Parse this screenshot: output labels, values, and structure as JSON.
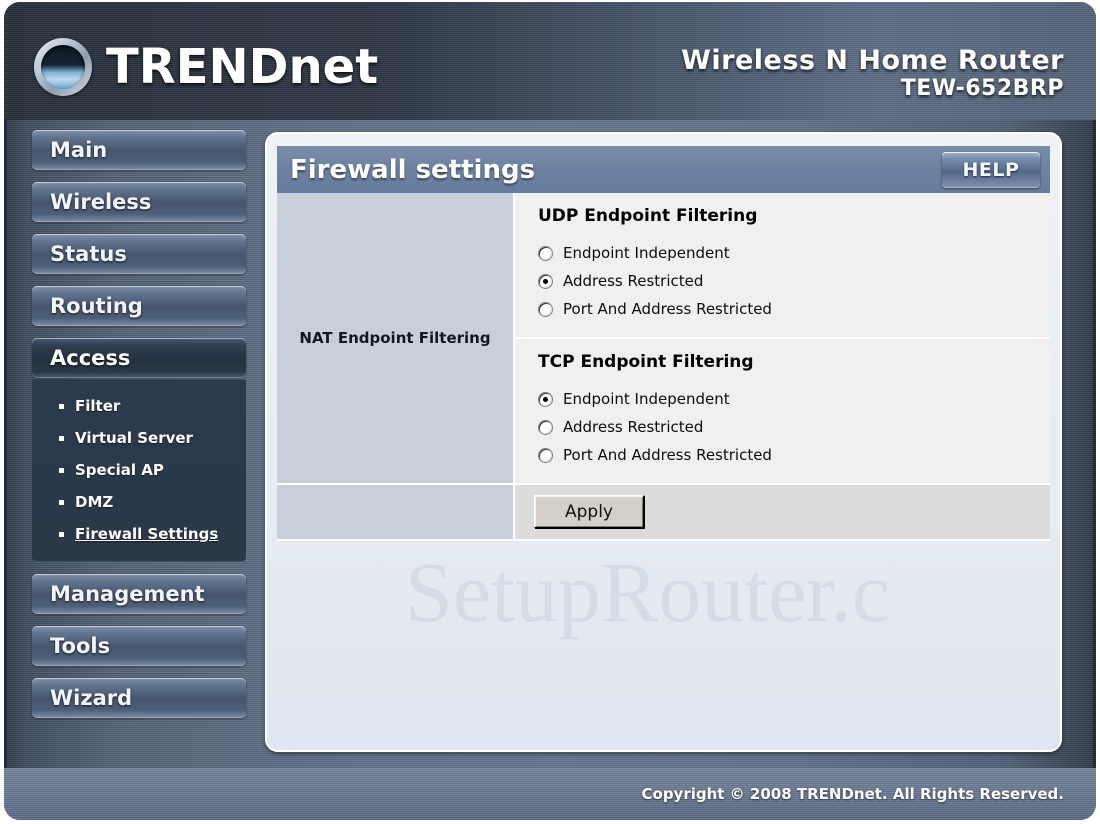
{
  "brand": {
    "logo_text": "TRENDnet",
    "logo_icon": "trendnet-swirl-logo"
  },
  "header": {
    "product_line1": "Wireless N Home Router",
    "product_line2": "TEW-652BRP"
  },
  "sidebar": {
    "items": [
      {
        "label": "Main",
        "active": false
      },
      {
        "label": "Wireless",
        "active": false
      },
      {
        "label": "Status",
        "active": false
      },
      {
        "label": "Routing",
        "active": false
      },
      {
        "label": "Access",
        "active": true
      }
    ],
    "submenu": [
      {
        "label": "Filter",
        "current": false
      },
      {
        "label": "Virtual Server",
        "current": false
      },
      {
        "label": "Special AP",
        "current": false
      },
      {
        "label": "DMZ",
        "current": false
      },
      {
        "label": "Firewall Settings",
        "current": true
      }
    ],
    "items_after": [
      {
        "label": "Management",
        "active": false
      },
      {
        "label": "Tools",
        "active": false
      },
      {
        "label": "Wizard",
        "active": false
      }
    ]
  },
  "panel": {
    "title": "Firewall settings",
    "help_label": "HELP",
    "row_label": "NAT Endpoint Filtering",
    "udp": {
      "title": "UDP Endpoint Filtering",
      "options": [
        {
          "label": "Endpoint Independent",
          "selected": false
        },
        {
          "label": "Address Restricted",
          "selected": true
        },
        {
          "label": "Port And Address Restricted",
          "selected": false
        }
      ]
    },
    "tcp": {
      "title": "TCP Endpoint Filtering",
      "options": [
        {
          "label": "Endpoint Independent",
          "selected": true
        },
        {
          "label": "Address Restricted",
          "selected": false
        },
        {
          "label": "Port And Address Restricted",
          "selected": false
        }
      ]
    },
    "apply_label": "Apply"
  },
  "watermark": "SetupRouter.c",
  "footer": {
    "copyright": "Copyright © 2008 TRENDnet. All Rights Reserved."
  },
  "colors": {
    "frame_dark": "#232c3a",
    "title_bar": "#6d82a1",
    "sidebar_active": "#2a3848",
    "left_cell": "#c7cfdb",
    "right_cell": "#f0f0f0",
    "apply_row": "#dcdcdc"
  }
}
